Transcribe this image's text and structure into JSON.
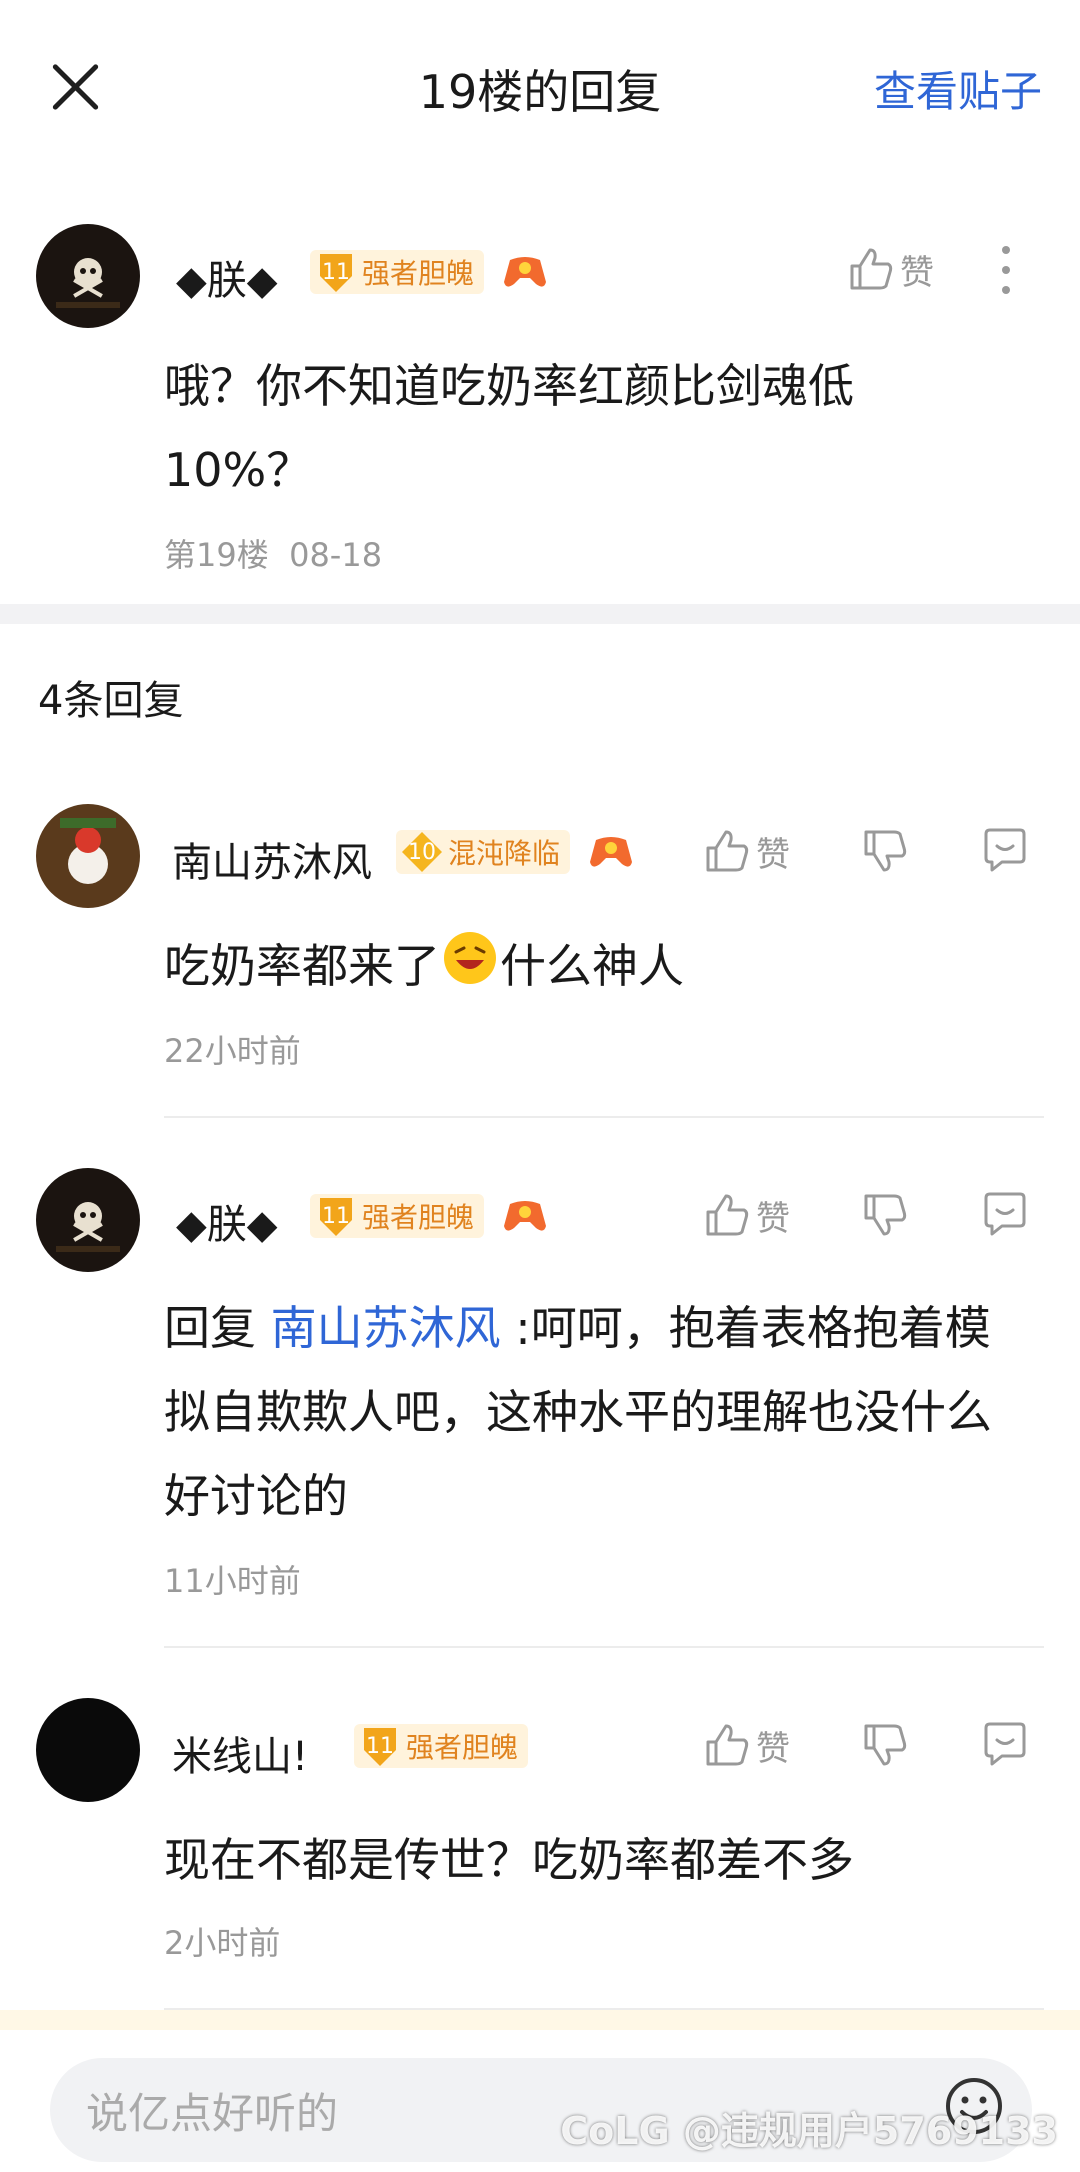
{
  "header": {
    "title": "19楼的回复",
    "view_post": "查看贴子"
  },
  "main_post": {
    "username": "◆朕◆",
    "badge_level": "11",
    "badge_text": "强者胆魄",
    "like_label": "赞",
    "content": "哦？你不知道吃奶率红颜比剑魂低10%？",
    "floor": "第19楼",
    "date": "08-18"
  },
  "replies_count": "4条回复",
  "replies": [
    {
      "username": "南山苏沐风",
      "badge_level": "10",
      "badge_text": "混沌降临",
      "like_label": "赞",
      "content_a": "吃奶率都来了",
      "content_b": "什么神人",
      "time": "22小时前"
    },
    {
      "username": "◆朕◆",
      "badge_level": "11",
      "badge_text": "强者胆魄",
      "like_label": "赞",
      "reply_prefix": "回复 ",
      "mention": "南山苏沐风",
      "content": " :呵呵，抱着表格抱着模拟自欺欺人吧，这种水平的理解也没什么好讨论的",
      "time": "11小时前"
    },
    {
      "username": "米线山!",
      "badge_level": "11",
      "badge_text": "强者胆魄",
      "like_label": "赞",
      "content": "现在不都是传世？吃奶率都差不多",
      "time": "2小时前"
    }
  ],
  "input": {
    "placeholder": "说亿点好听的"
  },
  "watermark": "CoLG @违规用户5769133",
  "colors": {
    "accent": "#2f66d6",
    "badge_orange": "#e0831f",
    "muted": "#999999"
  }
}
